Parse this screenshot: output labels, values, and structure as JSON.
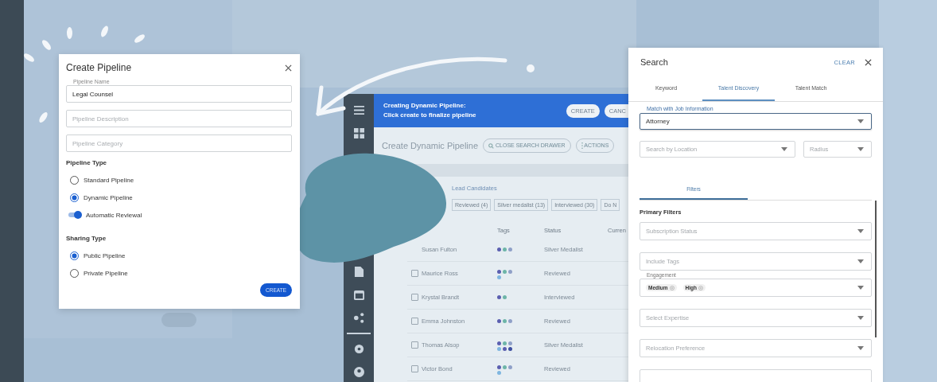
{
  "background_app": {
    "banner": {
      "lines": [
        "Creating Dynamic Pipeline:",
        "Click create to finalize pipeline"
      ],
      "buttons": [
        "CREATE",
        "CANC"
      ]
    },
    "title": "Create Dynamic Pipeline",
    "toolbar_buttons": [
      {
        "kind": "search",
        "label": "CLOSE SEARCH DRAWER"
      },
      {
        "kind": "menu",
        "label": "ACTIONS"
      }
    ],
    "candidates_label": "Lead Candidates",
    "filter_chips": [
      "Reviewed (4)",
      "Silver medalist (13)",
      "Interviewed (30)",
      "Do N"
    ],
    "table": {
      "columns": [
        "Tags",
        "Status",
        "Curren"
      ],
      "rows": [
        {
          "name": "Susan Fulton",
          "tags": [
            {
              "color": "#5b5fb0"
            },
            {
              "color": "#6db5a8"
            },
            {
              "color": "#8fa0c8"
            }
          ],
          "status": "Silver Medalist"
        },
        {
          "name": "Maurice Ross",
          "checked": false,
          "tags": [
            {
              "color": "#5b5fb0"
            },
            {
              "color": "#6db5a8"
            },
            {
              "color": "#8fa0c8"
            },
            {
              "color": "#7fb6e0"
            }
          ],
          "status": "Reviewed"
        },
        {
          "name": "Krystal Brandt",
          "checked": false,
          "tags": [
            {
              "color": "#5b5fb0"
            },
            {
              "color": "#6db5a8"
            }
          ],
          "status": "Interviewed"
        },
        {
          "name": "Emma Johnston",
          "checked": false,
          "tags": [
            {
              "color": "#5b5fb0"
            },
            {
              "color": "#6db5a8"
            },
            {
              "color": "#8fa0c8"
            }
          ],
          "status": "Reviewed"
        },
        {
          "name": "Thomas Alsop",
          "checked": false,
          "tags": [
            {
              "color": "#5b5fb0"
            },
            {
              "color": "#6db5a8"
            },
            {
              "color": "#8fa0c8"
            },
            {
              "color": "#7fb6e0"
            },
            {
              "color": "#5b5fb0"
            },
            {
              "color": "#3d4fa0"
            }
          ],
          "status": "Silver Medalist"
        },
        {
          "name": "Victor Bond",
          "checked": false,
          "tags": [
            {
              "color": "#5b5fb0"
            },
            {
              "color": "#6db5a8"
            },
            {
              "color": "#8fa0c8"
            },
            {
              "color": "#7fb6e0"
            }
          ],
          "status": "Reviewed"
        }
      ]
    }
  },
  "create_pipeline": {
    "title": "Create Pipeline",
    "fields": [
      {
        "label": "Pipeline Name",
        "value": "Legal Counsel"
      },
      {
        "placeholder": "Pipeline Description"
      },
      {
        "placeholder": "Pipeline Category"
      }
    ],
    "sections": [
      {
        "title": "Pipeline Type",
        "options": [
          {
            "kind": "radio",
            "label": "Standard Pipeline",
            "selected": false
          },
          {
            "kind": "radio",
            "label": "Dynamic Pipeline",
            "selected": true
          },
          {
            "kind": "toggle",
            "label": "Automatic Reviewal",
            "on": true
          }
        ]
      },
      {
        "title": "Sharing Type",
        "options": [
          {
            "kind": "radio",
            "label": "Public Pipeline",
            "selected": true
          },
          {
            "kind": "radio",
            "label": "Private Pipeline",
            "selected": false
          }
        ]
      }
    ],
    "button": "CREATE"
  },
  "search_drawer": {
    "title": "Search",
    "clear": "CLEAR",
    "tabs": [
      {
        "label": "Keyword",
        "selected": false
      },
      {
        "label": "Talent Discovery",
        "selected": true
      },
      {
        "label": "Talent Match",
        "selected": false
      }
    ],
    "job_field": {
      "label": "Match with Job Information",
      "value": "Attorney"
    },
    "location": {
      "placeholder": "Search by Location"
    },
    "radius": {
      "placeholder": "Radius"
    },
    "subtabs": [
      {
        "label": "Filters",
        "selected": true
      }
    ],
    "section_title": "Primary Filters",
    "filters": [
      {
        "kind": "select",
        "placeholder": "Subscription Status"
      },
      {
        "kind": "select",
        "placeholder": "Include Tags"
      },
      {
        "kind": "chips",
        "label": "Engagement",
        "chips": [
          "Medium",
          "High"
        ]
      },
      {
        "kind": "select",
        "placeholder": "Select Expertise"
      },
      {
        "kind": "select",
        "placeholder": "Relocation Preference"
      },
      {
        "kind": "cut_off"
      }
    ]
  }
}
